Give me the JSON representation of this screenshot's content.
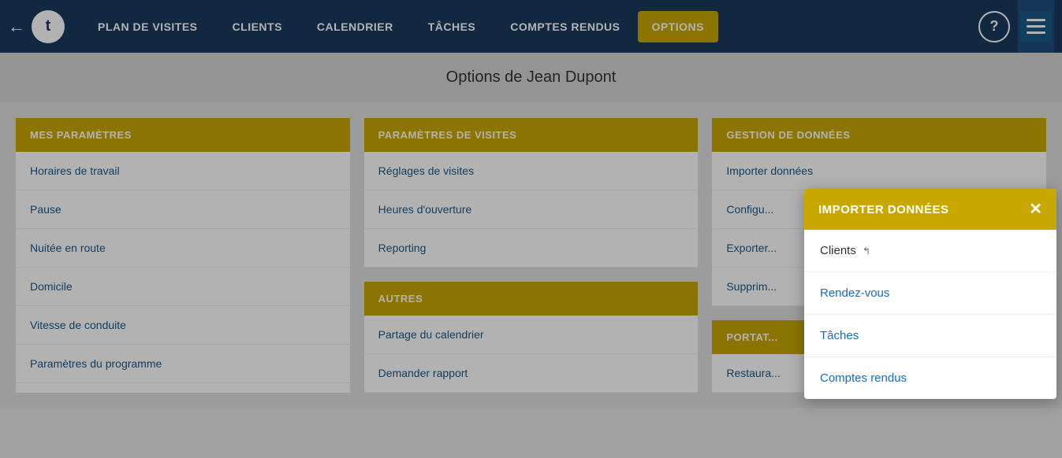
{
  "nav": {
    "back_label": "←",
    "logo_text": "t",
    "items": [
      {
        "id": "plan-de-visites",
        "label": "PLAN DE VISITES"
      },
      {
        "id": "clients",
        "label": "CLIENTS"
      },
      {
        "id": "calendrier",
        "label": "CALENDRIER"
      },
      {
        "id": "taches",
        "label": "TÂCHES"
      },
      {
        "id": "comptes-rendus",
        "label": "COMPTES RENDUS"
      },
      {
        "id": "options",
        "label": "OPTIONS"
      }
    ],
    "help_label": "?",
    "menu_label": "☰"
  },
  "page_title": "Options de Jean Dupont",
  "columns": [
    {
      "id": "mes-parametres",
      "header": "MES PARAMÈTRES",
      "items": [
        "Horaires de travail",
        "Pause",
        "Nuitée en route",
        "Domicile",
        "Vitesse de conduite",
        "Paramètres du programme"
      ]
    },
    {
      "id": "parametres-de-visites",
      "header": "PARAMÈTRES DE VISITES",
      "items": [
        "Réglages de visites",
        "Heures d'ouverture",
        "Reporting"
      ]
    },
    {
      "id": "autres",
      "header": "AUTRES",
      "items": [
        "Partage du calendrier",
        "Demander rapport"
      ]
    },
    {
      "id": "gestion-de-donnees",
      "header": "GESTION DE DONNÉES",
      "items": [
        "Importer données",
        "Configu...",
        "Exporter...",
        "Supprim..."
      ]
    },
    {
      "id": "portat",
      "header": "PORTAT...",
      "items": [
        "Restaura..."
      ]
    }
  ],
  "modal": {
    "title": "IMPORTER DONNÉES",
    "close_label": "✕",
    "items": [
      {
        "id": "clients",
        "label": "Clients",
        "type": "default"
      },
      {
        "id": "rendez-vous",
        "label": "Rendez-vous",
        "type": "link"
      },
      {
        "id": "taches",
        "label": "Tâches",
        "type": "link"
      },
      {
        "id": "comptes-rendus",
        "label": "Comptes rendus",
        "type": "link"
      }
    ]
  }
}
